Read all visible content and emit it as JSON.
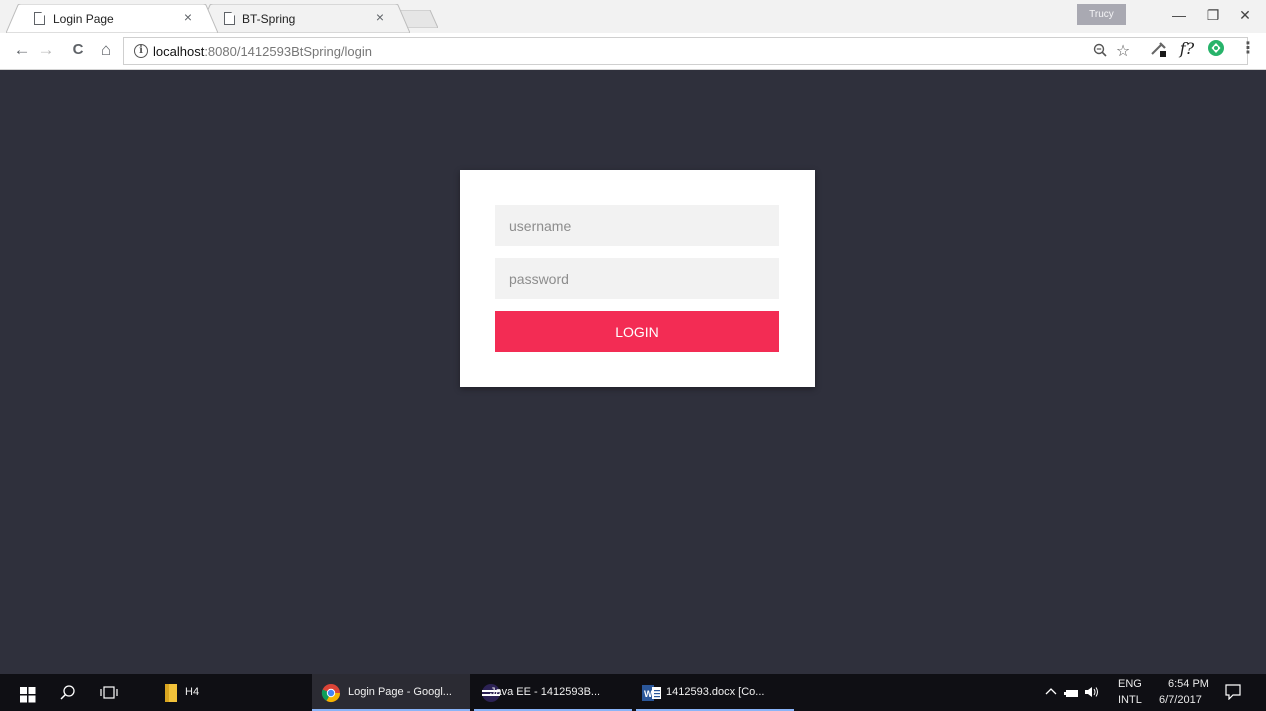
{
  "browser": {
    "tabs": [
      {
        "title": "Login Page",
        "active": true
      },
      {
        "title": "BT-Spring",
        "active": false
      }
    ],
    "tab_close_glyph": "×",
    "profile_name": "Trucy",
    "window_controls": {
      "minimize": "—",
      "restore": "❐",
      "close": "✕"
    },
    "nav": {
      "back": "←",
      "forward": "→",
      "reload": "C",
      "home": "⌂"
    },
    "url_host": "localhost",
    "url_rest": ":8080/1412593BtSpring/login",
    "extensions": {
      "function_label": "f?"
    },
    "menu_glyph": "⋮"
  },
  "login": {
    "username_placeholder": "username",
    "password_placeholder": "password",
    "button_label": "LOGIN"
  },
  "colors": {
    "page_background": "#2f303c",
    "card_background": "#ffffff",
    "field_background": "#f2f2f2",
    "button_accent": "#f32c54"
  },
  "taskbar": {
    "items": [
      {
        "label": "H4"
      },
      {
        "label": "Login Page - Googl..."
      },
      {
        "label": "Java EE - 1412593B..."
      },
      {
        "label": "1412593.docx [Co..."
      }
    ],
    "language_top": "ENG",
    "language_bottom": "INTL",
    "time": "6:54 PM",
    "date": "6/7/2017"
  }
}
